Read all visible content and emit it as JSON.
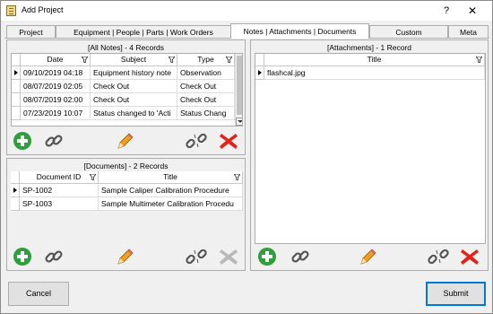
{
  "window": {
    "title": "Add Project",
    "help_glyph": "?",
    "close_glyph": "✕"
  },
  "tabs": [
    {
      "label": "Project"
    },
    {
      "label": "Equipment | People | Parts | Work Orders"
    },
    {
      "label": "Notes | Attachments | Documents"
    },
    {
      "label": "Custom"
    },
    {
      "label": "Meta"
    }
  ],
  "notes": {
    "header": "[All Notes] - 4 Records",
    "columns": [
      "Date",
      "Subject",
      "Type"
    ],
    "rows": [
      {
        "date": "09/10/2019 04:18",
        "subject": "Equipment history note",
        "type": "Observation"
      },
      {
        "date": "08/07/2019 02:05",
        "subject": "Check Out",
        "type": "Check Out"
      },
      {
        "date": "08/07/2019 02:00",
        "subject": "Check Out",
        "type": "Check Out"
      },
      {
        "date": "07/23/2019 10:07",
        "subject": "Status changed to 'Acti",
        "type": "Status Chang"
      }
    ]
  },
  "documents": {
    "header": "[Documents] - 2 Records",
    "columns": [
      "Document ID",
      "Title"
    ],
    "rows": [
      {
        "id": "SP-1002",
        "title": "Sample Caliper Calibration Procedure"
      },
      {
        "id": "SP-1003",
        "title": "Sample Multimeter Calibration Procedu"
      }
    ]
  },
  "attachments": {
    "header": "[Attachments] - 1 Record",
    "columns": [
      "Title"
    ],
    "rows": [
      {
        "title": "flashcal.jpg"
      }
    ]
  },
  "toolbar_icons": [
    "add-icon",
    "link-icon",
    "edit-pencil-icon",
    "unlink-icon",
    "delete-x-icon"
  ],
  "colors": {
    "add": "#2e9e3e",
    "delete": "#e0241b",
    "pencil": "#f0a020",
    "link": "#6a6a6a"
  },
  "footer": {
    "cancel_label": "Cancel",
    "submit_label": "Submit"
  }
}
